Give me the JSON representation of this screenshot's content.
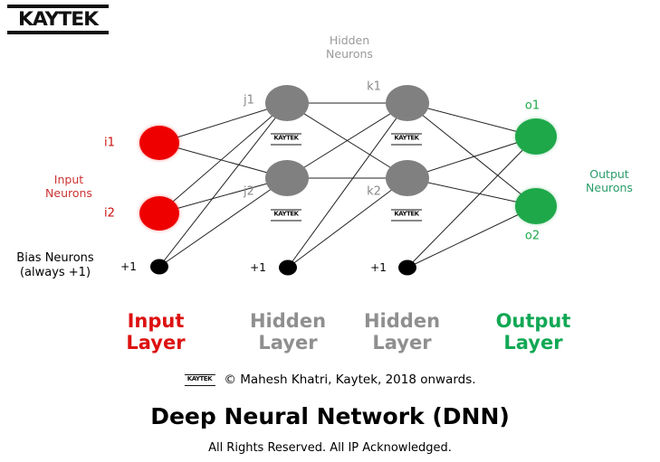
{
  "brand": {
    "logo_text": "KAYTEK",
    "watermark_text": "KAYTEK"
  },
  "diagram": {
    "top_caption": "Hidden\nNeurons",
    "top_caption_line1": "Hidden",
    "top_caption_line2": "Neurons",
    "input_caption_line1": "Input",
    "input_caption_line2": "Neurons",
    "output_caption_line1": "Output",
    "output_caption_line2": "Neurons",
    "bias_caption_line1": "Bias Neurons",
    "bias_caption_line2": "(always +1)",
    "colors": {
      "input": "#ee0000",
      "hidden": "#808080",
      "output": "#1fa84a",
      "bias": "#000000",
      "edge": "#222222"
    },
    "nodes": {
      "input": [
        {
          "id": "i1",
          "label": "i1"
        },
        {
          "id": "i2",
          "label": "i2"
        }
      ],
      "hidden1": [
        {
          "id": "j1",
          "label": "j1"
        },
        {
          "id": "j2",
          "label": "j2"
        }
      ],
      "hidden2": [
        {
          "id": "k1",
          "label": "k1"
        },
        {
          "id": "k2",
          "label": "k2"
        }
      ],
      "output": [
        {
          "id": "o1",
          "label": "o1"
        },
        {
          "id": "o2",
          "label": "o2"
        }
      ],
      "bias": [
        {
          "id": "b1",
          "label": "+1"
        },
        {
          "id": "b2",
          "label": "+1"
        },
        {
          "id": "b3",
          "label": "+1"
        }
      ]
    }
  },
  "layer_titles": [
    {
      "id": "input-layer",
      "line1": "Input",
      "line2": "Layer",
      "color": "#dd1111"
    },
    {
      "id": "hidden-layer-1",
      "line1": "Hidden",
      "line2": "Layer",
      "color": "#8f8f8f"
    },
    {
      "id": "hidden-layer-2",
      "line1": "Hidden",
      "line2": "Layer",
      "color": "#8f8f8f"
    },
    {
      "id": "output-layer",
      "line1": "Output",
      "line2": "Layer",
      "color": "#11a855"
    }
  ],
  "footer": {
    "copyright": "© Mahesh Khatri, Kaytek, 2018 onwards.",
    "title": "Deep Neural Network (DNN)",
    "rights": "All Rights Reserved.  All IP Acknowledged."
  }
}
